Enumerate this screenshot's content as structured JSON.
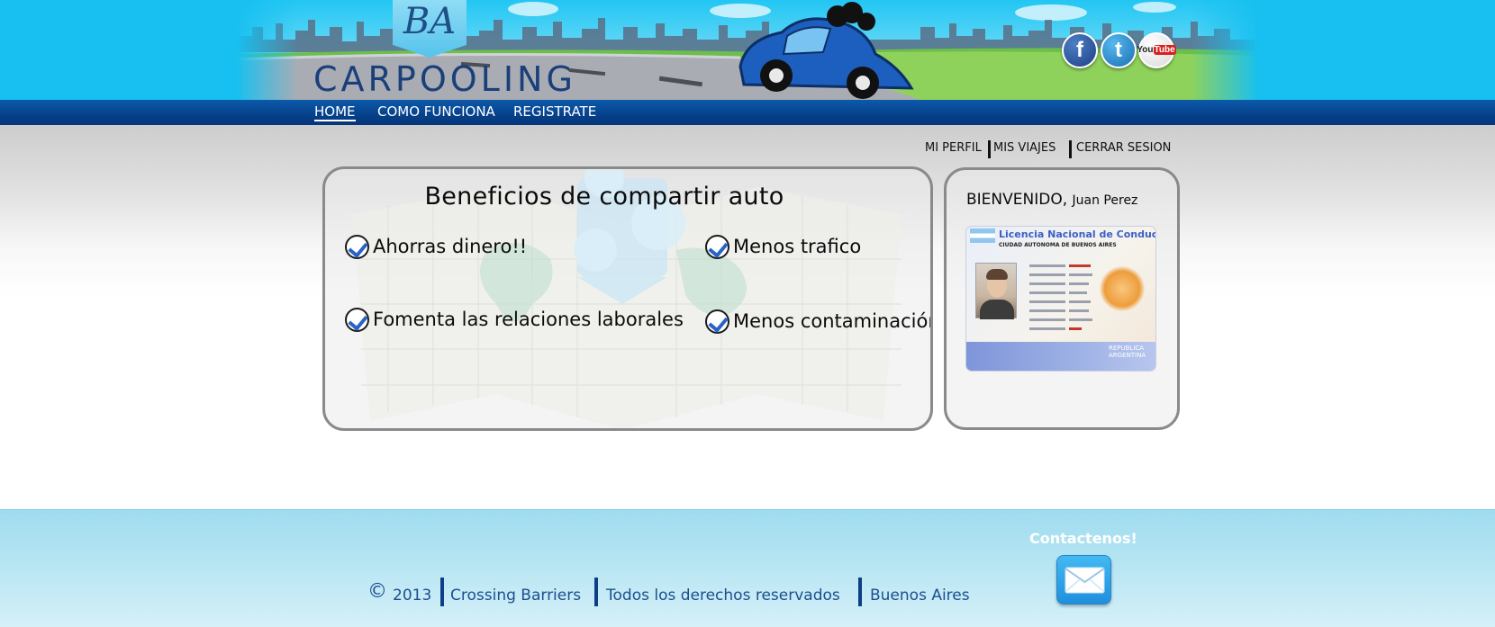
{
  "header": {
    "logo_initials": "BA",
    "logo_word": "CARPOOLING",
    "social": [
      {
        "name": "facebook",
        "glyph": "f"
      },
      {
        "name": "twitter",
        "glyph": "t"
      },
      {
        "name": "youtube",
        "glyph_you": "You",
        "glyph_tube": "Tube"
      }
    ]
  },
  "nav": {
    "items": [
      {
        "label": "HOME",
        "active": true
      },
      {
        "label": "COMO FUNCIONA",
        "active": false
      },
      {
        "label": "REGISTRATE",
        "active": false
      }
    ]
  },
  "user_menu": {
    "items": [
      "MI PERFIL",
      "MIS VIAJES",
      "CERRAR SESION"
    ]
  },
  "benefits": {
    "title": "Beneficios de compartir auto",
    "items": [
      "Ahorras dinero!!",
      "Menos trafico",
      "Fomenta las relaciones laborales",
      "Menos contaminación"
    ]
  },
  "profile": {
    "welcome_label": "BIENVENIDO,",
    "user_name": "Juan Perez",
    "license": {
      "title": "Licencia Nacional de Conducir",
      "subtitle": "CIUDAD AUTONOMA DE BUENOS AIRES",
      "footer_text": "REPUBLICA ARGENTINA"
    }
  },
  "footer": {
    "copyright_symbol": "©",
    "year": "2013",
    "company": "Crossing Barriers",
    "rights": "Todos los derechos reservados",
    "city": "Buenos Aires",
    "contact_label": "Contactenos!"
  },
  "colors": {
    "header_sky": "#17c0f0",
    "nav_blue": "#06418b",
    "text_dark": "#0b0b0b",
    "footer_text": "#1c4f8f",
    "panel_border": "#8a8a8a",
    "check_blue": "#2a63c7"
  },
  "icons": [
    "facebook-icon",
    "twitter-icon",
    "youtube-icon",
    "check-icon",
    "mail-icon"
  ]
}
